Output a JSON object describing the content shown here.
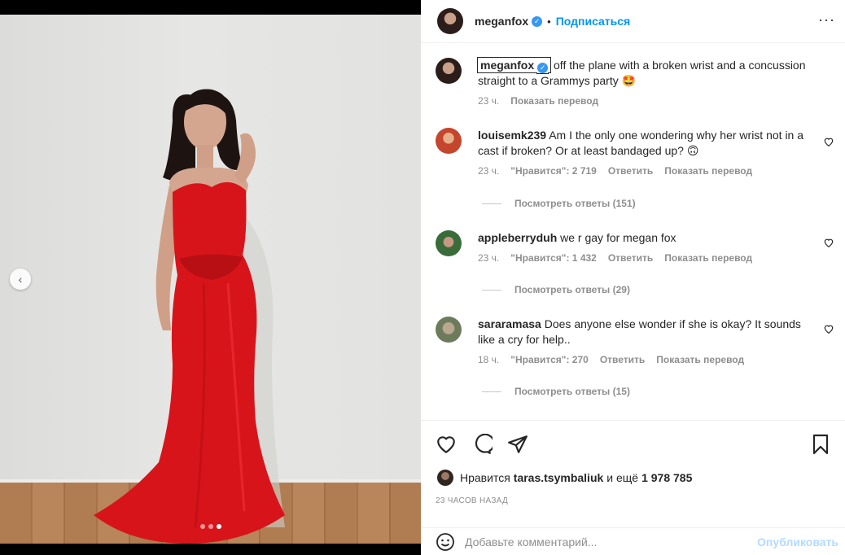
{
  "post": {
    "author": "meganfox",
    "verified_icon": "verified-badge-icon",
    "follow_label": "Подписаться",
    "bullet": "•",
    "more_icon": "more-options-icon",
    "more_glyph": "···"
  },
  "caption": {
    "author": "meganfox",
    "text": "off the plane with a broken wrist and a concussion straight to a Grammys party",
    "emoji": "🤩",
    "time": "23 ч.",
    "translate_label": "Показать перевод"
  },
  "comments": [
    {
      "user": "louisemk239",
      "text": "Am I the only one wondering why her wrist not in a cast if broken? Or at least bandaged up?",
      "emoji": "🙃",
      "time": "23 ч.",
      "likes": "\"Нравится\": 2 719",
      "reply_label": "Ответить",
      "translate_label": "Показать перевод",
      "view_replies": "Посмотреть ответы (151)"
    },
    {
      "user": "appleberryduh",
      "text": "we r gay for megan fox",
      "emoji": "",
      "time": "23 ч.",
      "likes": "\"Нравится\": 1 432",
      "reply_label": "Ответить",
      "translate_label": "Показать перевод",
      "view_replies": "Посмотреть ответы (29)"
    },
    {
      "user": "sararamasa",
      "text": "Does anyone else wonder if she is okay? It sounds like a cry for help..",
      "emoji": "",
      "time": "18 ч.",
      "likes": "\"Нравится\": 270",
      "reply_label": "Ответить",
      "translate_label": "Показать перевод",
      "view_replies": "Посмотреть ответы (15)"
    }
  ],
  "actions": {
    "like_icon": "heart-icon",
    "comment_icon": "comment-icon",
    "share_icon": "share-icon",
    "save_icon": "bookmark-icon"
  },
  "likes": {
    "prefix": "Нравится",
    "user": "taras.tsymbaliuk",
    "and_more": "и ещё",
    "count": "1 978 785"
  },
  "timestamp": "23 ЧАСОВ НАЗАД",
  "composer": {
    "placeholder": "Добавьте комментарий...",
    "publish_label": "Опубликовать",
    "emoji_icon": "smiley-icon"
  },
  "media": {
    "prev_icon": "chevron-left-icon",
    "prev_glyph": "‹",
    "slides_total": 3,
    "slide_active": 3,
    "dress_color": "#d8141b"
  }
}
